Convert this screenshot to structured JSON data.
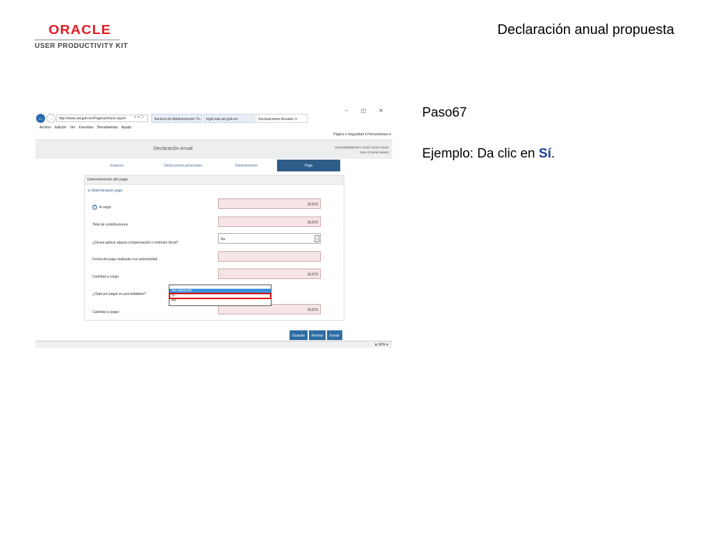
{
  "slide": {
    "logo_brand": "ORACLE",
    "logo_product": "USER PRODUCTIVITY KIT",
    "title": "Declaración anual propuesta",
    "step": "Paso67",
    "instruction_prefix": "Ejemplo: Da clic en ",
    "instruction_target": "Sí",
    "instruction_suffix": "."
  },
  "browser": {
    "window_controls": "– ◰ ✕",
    "address": "http://www.sat.gob.mx/Paginas/Inicio.aspx#",
    "tabs": [
      {
        "label": "Servicio de Administración Tri..."
      },
      {
        "label": "login.siat.sat.gob.mx"
      },
      {
        "label": "Declaraciones Anuales",
        "close": "✕"
      }
    ],
    "menu": [
      "Archivo",
      "Edición",
      "Ver",
      "Favoritos",
      "Herramientas",
      "Ayuda"
    ],
    "commands": "Página ▾  Seguridad ▾  Herramientas ▾",
    "zoom": "90%"
  },
  "app": {
    "title": "Declaración Anual",
    "user_line1": "XXXX000000XX0 | XXXX XXXX XXXX",
    "user_line2": "Inicio | Cerrar Sesión",
    "tabs": [
      {
        "label": "Ingresos"
      },
      {
        "label": "Deducciones personales"
      },
      {
        "label": "Determinación"
      },
      {
        "label": "Pago"
      }
    ],
    "panel_title": "Determinación del pago",
    "section_title": "Determinación pago",
    "rows": [
      {
        "label": "A cargo",
        "value": "26,575"
      },
      {
        "label": "Total de contribuciones",
        "value": "26,575"
      },
      {
        "label": "¿Desea aplicar alguna compensación o estímulo fiscal?",
        "value": "No"
      },
      {
        "label": "Fecha del pago realizado con anterioridad",
        "value": ""
      },
      {
        "label": "Cantidad a cargo",
        "value": "26,575"
      },
      {
        "label": "¿Opta por pagar en parcialidades?",
        "value": ""
      },
      {
        "label": "Cantidad a pagar",
        "value": "26,575"
      }
    ],
    "dropdown_options": [
      "Sin selección",
      "Sí",
      "No"
    ],
    "buttons": {
      "save": "Guardar",
      "review": "Revisar",
      "send": "Enviar"
    }
  }
}
